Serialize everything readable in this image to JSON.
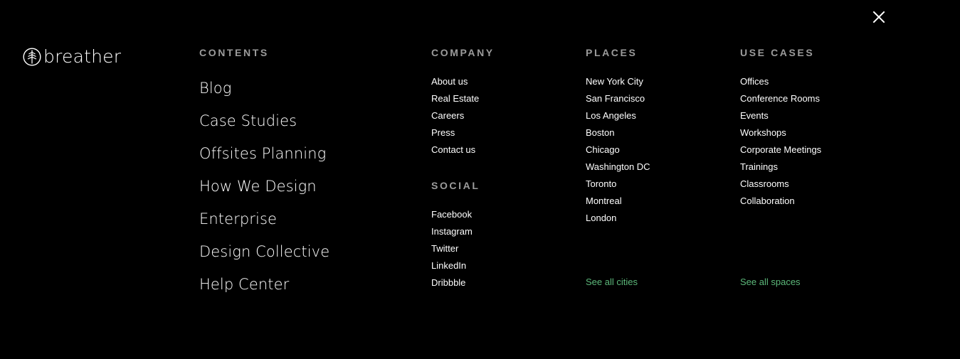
{
  "logo": {
    "text": "breather",
    "icon": "tree-logo-icon"
  },
  "close": {
    "icon": "close-icon"
  },
  "contents": {
    "heading": "CONTENTS",
    "items": [
      "Blog",
      "Case Studies",
      "Offsites Planning",
      "How We Design",
      "Enterprise",
      "Design Collective",
      "Help Center"
    ]
  },
  "company": {
    "heading": "COMPANY",
    "items": [
      "About us",
      "Real Estate",
      "Careers",
      "Press",
      "Contact us"
    ]
  },
  "social": {
    "heading": "SOCIAL",
    "items": [
      "Facebook",
      "Instagram",
      "Twitter",
      "LinkedIn",
      "Dribbble"
    ]
  },
  "places": {
    "heading": "PLACES",
    "items": [
      "New York City",
      "San Francisco",
      "Los Angeles",
      "Boston",
      "Chicago",
      "Washington DC",
      "Toronto",
      "Montreal",
      "London"
    ],
    "see_all": "See all cities"
  },
  "use_cases": {
    "heading": "USE CASES",
    "items": [
      "Offices",
      "Conference Rooms",
      "Events",
      "Workshops",
      "Corporate Meetings",
      "Trainings",
      "Classrooms",
      "Collaboration"
    ],
    "see_all": "See all spaces"
  },
  "colors": {
    "background": "#000000",
    "text": "#ffffff",
    "heading": "#9b9b9b",
    "link_accent": "#5cb87a"
  }
}
